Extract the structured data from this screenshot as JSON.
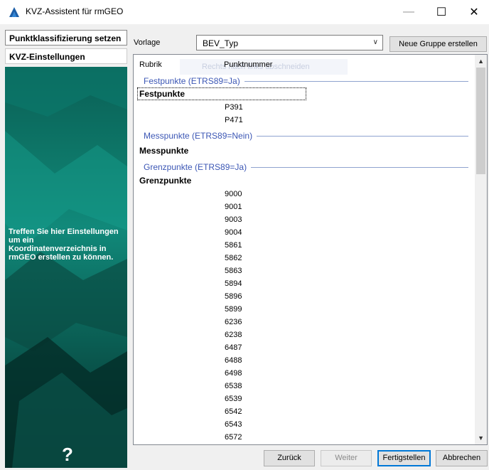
{
  "window": {
    "title": "KVZ-Assistent für rmGEO",
    "icon": "rmgeo-app-icon",
    "controls": {
      "minimize": "—",
      "maximize": "☐",
      "close": "✕"
    }
  },
  "sidebar": {
    "items": [
      {
        "label": "Punktklassifizierung setzen"
      },
      {
        "label": "KVZ-Einstellungen"
      }
    ],
    "info_text": "Treffen Sie hier Einstellungen um ein Koordinatenverzeichnis in rmGEO erstellen zu können.",
    "help_icon": "?"
  },
  "form": {
    "vorlage_label": "Vorlage",
    "vorlage_value": "BEV_Typ",
    "new_group_button": "Neue Gruppe erstellen"
  },
  "table": {
    "columns": [
      "Rubrik",
      "Punktnummer"
    ],
    "drag_ghost_text": "Rechts nach links abschneiden",
    "groups": [
      {
        "header": "Festpunkte (ETRS89=Ja)",
        "rubrik": "Festpunkte",
        "points": [
          "P391",
          "P471"
        ]
      },
      {
        "header": "Messpunkte (ETRS89=Nein)",
        "rubrik": "Messpunkte",
        "points": []
      },
      {
        "header": "Grenzpunkte (ETRS89=Ja)",
        "rubrik": "Grenzpunkte",
        "points": [
          "9000",
          "9001",
          "9003",
          "9004",
          "5861",
          "5862",
          "5863",
          "5894",
          "5896",
          "5899",
          "6236",
          "6238",
          "6487",
          "6488",
          "6498",
          "6538",
          "6539",
          "6542",
          "6543",
          "6572"
        ]
      }
    ]
  },
  "buttons": {
    "back": "Zurück",
    "next": "Weiter",
    "finish": "Fertigstellen",
    "cancel": "Abbrechen"
  }
}
